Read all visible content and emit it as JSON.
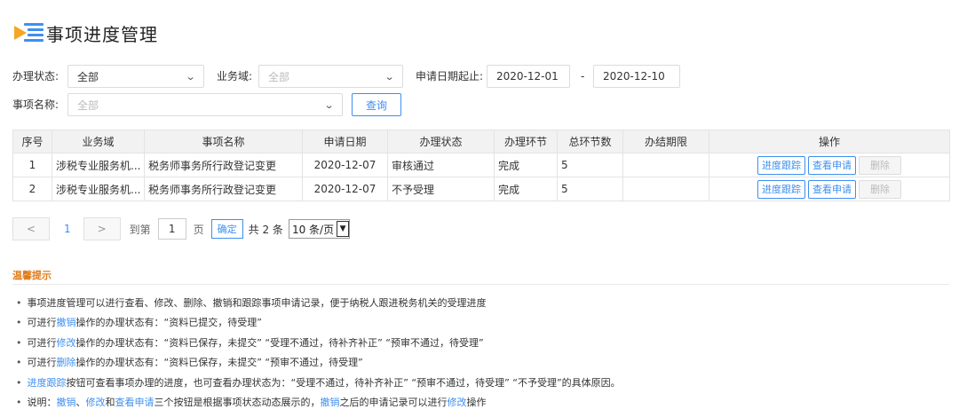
{
  "page": {
    "title": "事项进度管理"
  },
  "filters": {
    "status_label": "办理状态:",
    "status_value": "全部",
    "domain_label": "业务域:",
    "domain_placeholder": "全部",
    "date_label": "申请日期起止:",
    "date_from": "2020-12-01",
    "date_sep": "-",
    "date_to": "2020-12-10",
    "item_label": "事项名称:",
    "item_placeholder": "全部",
    "query_button": "查询"
  },
  "table": {
    "headers": [
      "序号",
      "业务域",
      "事项名称",
      "申请日期",
      "办理状态",
      "办理环节",
      "总环节数",
      "办结期限",
      "操作"
    ],
    "rows": [
      {
        "no": "1",
        "domain": "涉税专业服务机...",
        "item": "税务师事务所行政登记变更",
        "date": "2020-12-07",
        "status": "审核通过",
        "stage": "完成",
        "total": "5",
        "deadline": ""
      },
      {
        "no": "2",
        "domain": "涉税专业服务机...",
        "item": "税务师事务所行政登记变更",
        "date": "2020-12-07",
        "status": "不予受理",
        "stage": "完成",
        "total": "5",
        "deadline": ""
      }
    ],
    "actions": {
      "track": "进度跟踪",
      "view": "查看申请",
      "delete": "删除"
    }
  },
  "pager": {
    "prev": "<",
    "current": "1",
    "next": ">",
    "goto_label": "到第",
    "page_input": "1",
    "page_unit": "页",
    "confirm": "确定",
    "total_text": "共 2 条",
    "page_size": "10 条/页"
  },
  "tips": {
    "title": "温馨提示",
    "line1": "事项进度管理可以进行查看、修改、删除、撤销和跟踪事项申请记录，便于纳税人跟进税务机关的受理进度",
    "line2_a": "可进行",
    "line2_hl": "撤销",
    "line2_b": "操作的办理状态有：“资料已提交，待受理”",
    "line3_a": "可进行",
    "line3_hl": "修改",
    "line3_b": "操作的办理状态有：“资料已保存，未提交”   “受理不通过，待补齐补正”   “预审不通过，待受理”",
    "line4_a": "可进行",
    "line4_hl": "删除",
    "line4_b": "操作的办理状态有：“资料已保存，未提交”   “预审不通过，待受理”",
    "line5_hl": "进度跟踪",
    "line5_b": "按钮可查看事项办理的进度，也可查看办理状态为：“受理不通过，待补齐补正”   “预审不通过，待受理”   “不予受理”的具体原因。",
    "line6_a": "说明：",
    "line6_hl1": "撤销",
    "line6_s1": "、",
    "line6_hl2": "修改",
    "line6_s2": "和",
    "line6_hl3": "查看申请",
    "line6_b": "三个按钮是根据事项状态动态展示的，",
    "line6_hl4": "撤销",
    "line6_c": "之后的申请记录可以进行",
    "line6_hl5": "修改",
    "line6_d": "操作"
  },
  "colors": {
    "accent": "#3d8ff0",
    "tip_title": "#e07b1a",
    "icon_orange": "#f5a623"
  },
  "icons": {
    "title": "list-play-icon",
    "dropdown": "chevron-down-icon"
  }
}
